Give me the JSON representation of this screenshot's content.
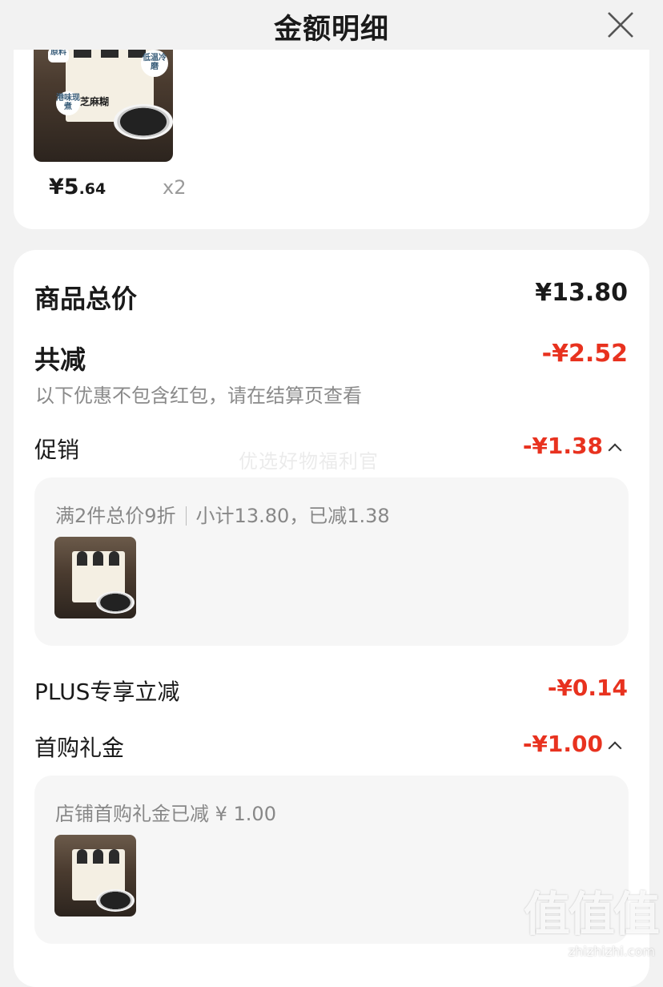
{
  "header": {
    "title": "金额明细",
    "close_icon": "close-icon"
  },
  "product": {
    "price_int": "¥5",
    "price_dec": ".64",
    "quantity": "x2",
    "image_tags": [
      "原料",
      "低温冷磨",
      "港味现煮"
    ],
    "image_box_text": "黑芝麻糊"
  },
  "summary": {
    "total_label": "商品总价",
    "total_value": "¥13.80",
    "reduce_label": "共减",
    "reduce_value": "-¥2.52",
    "reduce_note": "以下优惠不包含红包，请在结算页查看"
  },
  "promotion": {
    "label": "促销",
    "value": "-¥1.38",
    "detail_rule": "满2件总价9折",
    "detail_sub": "小计13.80，已减1.38"
  },
  "plus": {
    "label": "PLUS专享立减",
    "value": "-¥0.14"
  },
  "first_buy": {
    "label": "首购礼金",
    "value": "-¥1.00",
    "detail": "店铺首购礼金已减 ¥ 1.00"
  },
  "watermark": "优选好物福利官",
  "site_logo": {
    "glyphs": "值值值",
    "url": "zhizhizhi.com"
  },
  "colors": {
    "accent_red": "#e8321f",
    "background": "#f2f2f2",
    "card": "#ffffff"
  }
}
